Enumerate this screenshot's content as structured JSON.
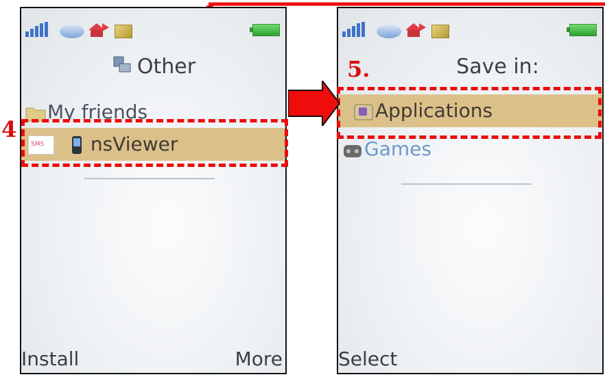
{
  "left_screen": {
    "title": "Other",
    "rows": [
      {
        "label": "My friends"
      },
      {
        "label": "nsViewer",
        "badge": "SMS"
      }
    ],
    "softkeys": {
      "left": "Install",
      "right": "More"
    },
    "callout": "4"
  },
  "right_screen": {
    "title": "Save in:",
    "rows": [
      {
        "label": "Applications"
      },
      {
        "label": "Games"
      }
    ],
    "softkeys": {
      "left": "Select"
    },
    "callout": "5."
  },
  "colors": {
    "highlight": "#dcc08a",
    "callout": "#ee0c0c",
    "battery": "#2fa02f",
    "signal": "#3f73c9"
  },
  "icons": [
    "signal-icon",
    "cloud-icon",
    "home-icon",
    "message-icon",
    "battery-icon",
    "folder-icon",
    "phone-app-icon",
    "applications-folder-icon",
    "games-folder-icon"
  ]
}
